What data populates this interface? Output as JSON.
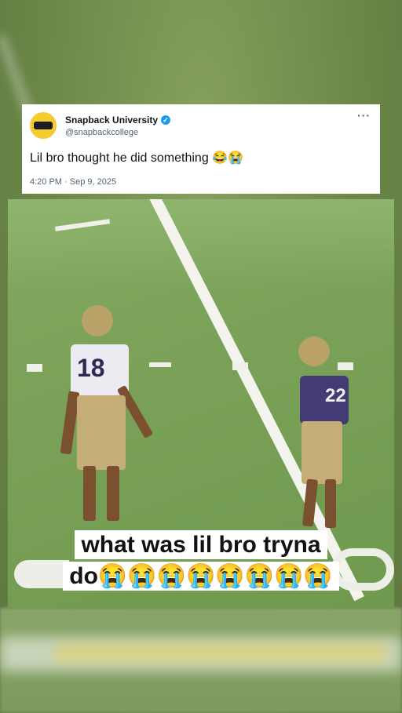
{
  "tweet": {
    "display_name": "Snapback University",
    "handle": "@snapbackcollege",
    "text": "Lil bro thought he did something 😂😭",
    "timestamp": "4:20 PM · Sep 9, 2025",
    "more_label": "···"
  },
  "video": {
    "caption": "what was lil bro tryna do😭😭😭😭😭😭😭😭",
    "player_left_number": "18",
    "player_right_number": "22"
  },
  "colors": {
    "avatar_bg": "#f3cc2e",
    "verified_badge": "#1d9bf0",
    "field_green": "#7aa157"
  },
  "icons": {
    "verified": "verified-badge-icon",
    "more": "more-options-icon",
    "avatar": "snapback-logo-icon"
  }
}
